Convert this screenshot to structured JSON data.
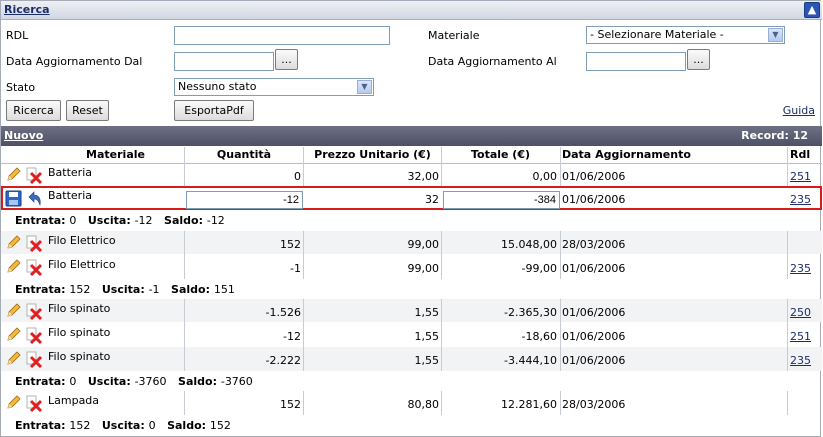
{
  "search": {
    "title": "Ricerca",
    "rdl_label": "RDL",
    "rdl_value": "",
    "materiale_label": "Materiale",
    "materiale_selected": "- Selezionare Materiale -",
    "data_dal_label": "Data Aggiornamento Dal",
    "data_dal_value": "",
    "data_al_label": "Data Aggiornamento Al",
    "data_al_value": "",
    "dots_label": "...",
    "stato_label": "Stato",
    "stato_selected": "Nessuno stato",
    "btn_ricerca": "Ricerca",
    "btn_reset": "Reset",
    "btn_esporta": "EsportaPdf",
    "guida": "Guida"
  },
  "list": {
    "nuovo": "Nuovo",
    "record": "Record: 12",
    "headers": [
      "Materiale",
      "Quantità",
      "Prezzo Unitario (€)",
      "Totale (€)",
      "Data Aggiornamento",
      "Rdl"
    ]
  },
  "rows": [
    {
      "materiale": "Batteria",
      "quantita": "0",
      "prezzo": "32,00",
      "totale": "0,00",
      "data": "01/06/2006",
      "rdl": "251"
    },
    {
      "materiale": "Batteria",
      "quantita": "-12",
      "prezzo": "32",
      "totale": "-384",
      "data": "01/06/2006",
      "rdl": "235"
    },
    {
      "materiale": "Filo Elettrico",
      "quantita": "152",
      "prezzo": "99,00",
      "totale": "15.048,00",
      "data": "28/03/2006",
      "rdl": ""
    },
    {
      "materiale": "Filo Elettrico",
      "quantita": "-1",
      "prezzo": "99,00",
      "totale": "-99,00",
      "data": "01/06/2006",
      "rdl": "235"
    },
    {
      "materiale": "Filo spinato",
      "quantita": "-1.526",
      "prezzo": "1,55",
      "totale": "-2.365,30",
      "data": "01/06/2006",
      "rdl": "250"
    },
    {
      "materiale": "Filo spinato",
      "quantita": "-12",
      "prezzo": "1,55",
      "totale": "-18,60",
      "data": "01/06/2006",
      "rdl": "251"
    },
    {
      "materiale": "Filo spinato",
      "quantita": "-2.222",
      "prezzo": "1,55",
      "totale": "-3.444,10",
      "data": "01/06/2006",
      "rdl": "235"
    },
    {
      "materiale": "Lampada",
      "quantita": "152",
      "prezzo": "80,80",
      "totale": "12.281,60",
      "data": "28/03/2006",
      "rdl": ""
    }
  ],
  "summaries": [
    {
      "entrata_label": "Entrata:",
      "entrata": "0",
      "uscita_label": "Uscita:",
      "uscita": "-12",
      "saldo_label": "Saldo:",
      "saldo": "-12"
    },
    {
      "entrata_label": "Entrata:",
      "entrata": "152",
      "uscita_label": "Uscita:",
      "uscita": "-1",
      "saldo_label": "Saldo:",
      "saldo": "151"
    },
    {
      "entrata_label": "Entrata:",
      "entrata": "0",
      "uscita_label": "Uscita:",
      "uscita": "-3760",
      "saldo_label": "Saldo:",
      "saldo": "-3760"
    },
    {
      "entrata_label": "Entrata:",
      "entrata": "152",
      "uscita_label": "Uscita:",
      "uscita": "0",
      "saldo_label": "Saldo:",
      "saldo": "152"
    }
  ],
  "icons": {
    "edit": "pencil-icon",
    "delete": "red-x-icon",
    "save": "floppy-save-icon",
    "undo": "undo-arrow-icon"
  },
  "colors": {
    "accent_bar": "#4d5066",
    "highlight_border": "#d41e1e",
    "link": "#1c2d6b"
  }
}
